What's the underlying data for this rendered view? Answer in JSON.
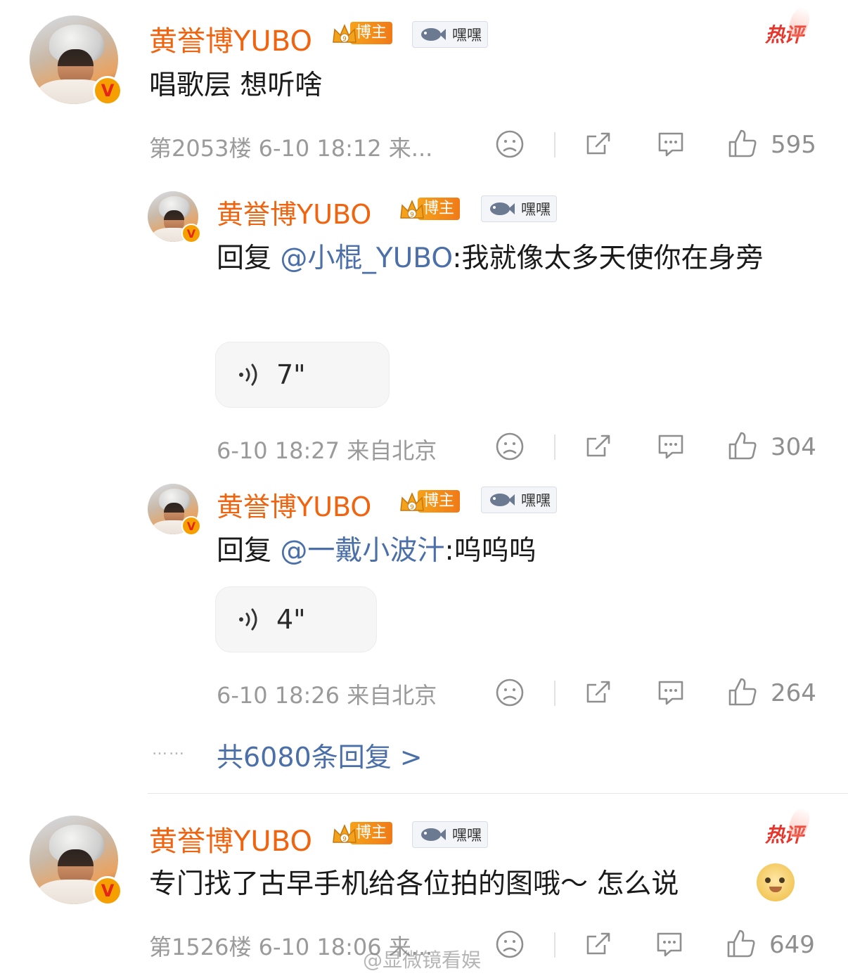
{
  "comments": [
    {
      "user": "黄誉博YUBO",
      "badge_label": "博主",
      "fan_label": "嘿嘿",
      "hot_label": "热评",
      "text": "唱歌层 想听啥",
      "meta": "第2053楼 6-10 18:12 来...",
      "likes": "595",
      "replies": [
        {
          "user": "黄誉博YUBO",
          "badge_label": "博主",
          "fan_label": "嘿嘿",
          "reply_prefix": "回复",
          "mention": "@小棍_YUBO",
          "text": ":我就像太多天使你在身旁",
          "voice_duration": "7\"",
          "meta": "6-10 18:27  来自北京",
          "likes": "304"
        },
        {
          "user": "黄誉博YUBO",
          "badge_label": "博主",
          "fan_label": "嘿嘿",
          "reply_prefix": "回复",
          "mention": "@一戴小波汁",
          "text": ":呜呜呜",
          "voice_duration": "4\"",
          "meta": "6-10 18:26  来自北京",
          "likes": "264"
        }
      ],
      "more_dots": "……",
      "more_replies": "共6080条回复 >"
    },
    {
      "user": "黄誉博YUBO",
      "badge_label": "博主",
      "fan_label": "嘿嘿",
      "hot_label": "热评",
      "text": "专门找了古早手机给各位拍的图哦～ 怎么说",
      "meta": "第1526楼 6-10 18:06 来...",
      "likes": "649"
    }
  ],
  "watermark": "@显微镜看娱",
  "colors": {
    "name": "#f0640f",
    "mention": "#4b6fa8",
    "hot": "#e8362c",
    "meta": "#9a9a9a"
  },
  "icons": [
    "avatar-v-badge",
    "crown-icon",
    "fish-icon",
    "dislike-face-icon",
    "share-icon",
    "comment-icon",
    "thumbs-up-icon",
    "voice-wave-icon",
    "doge-emoji"
  ]
}
